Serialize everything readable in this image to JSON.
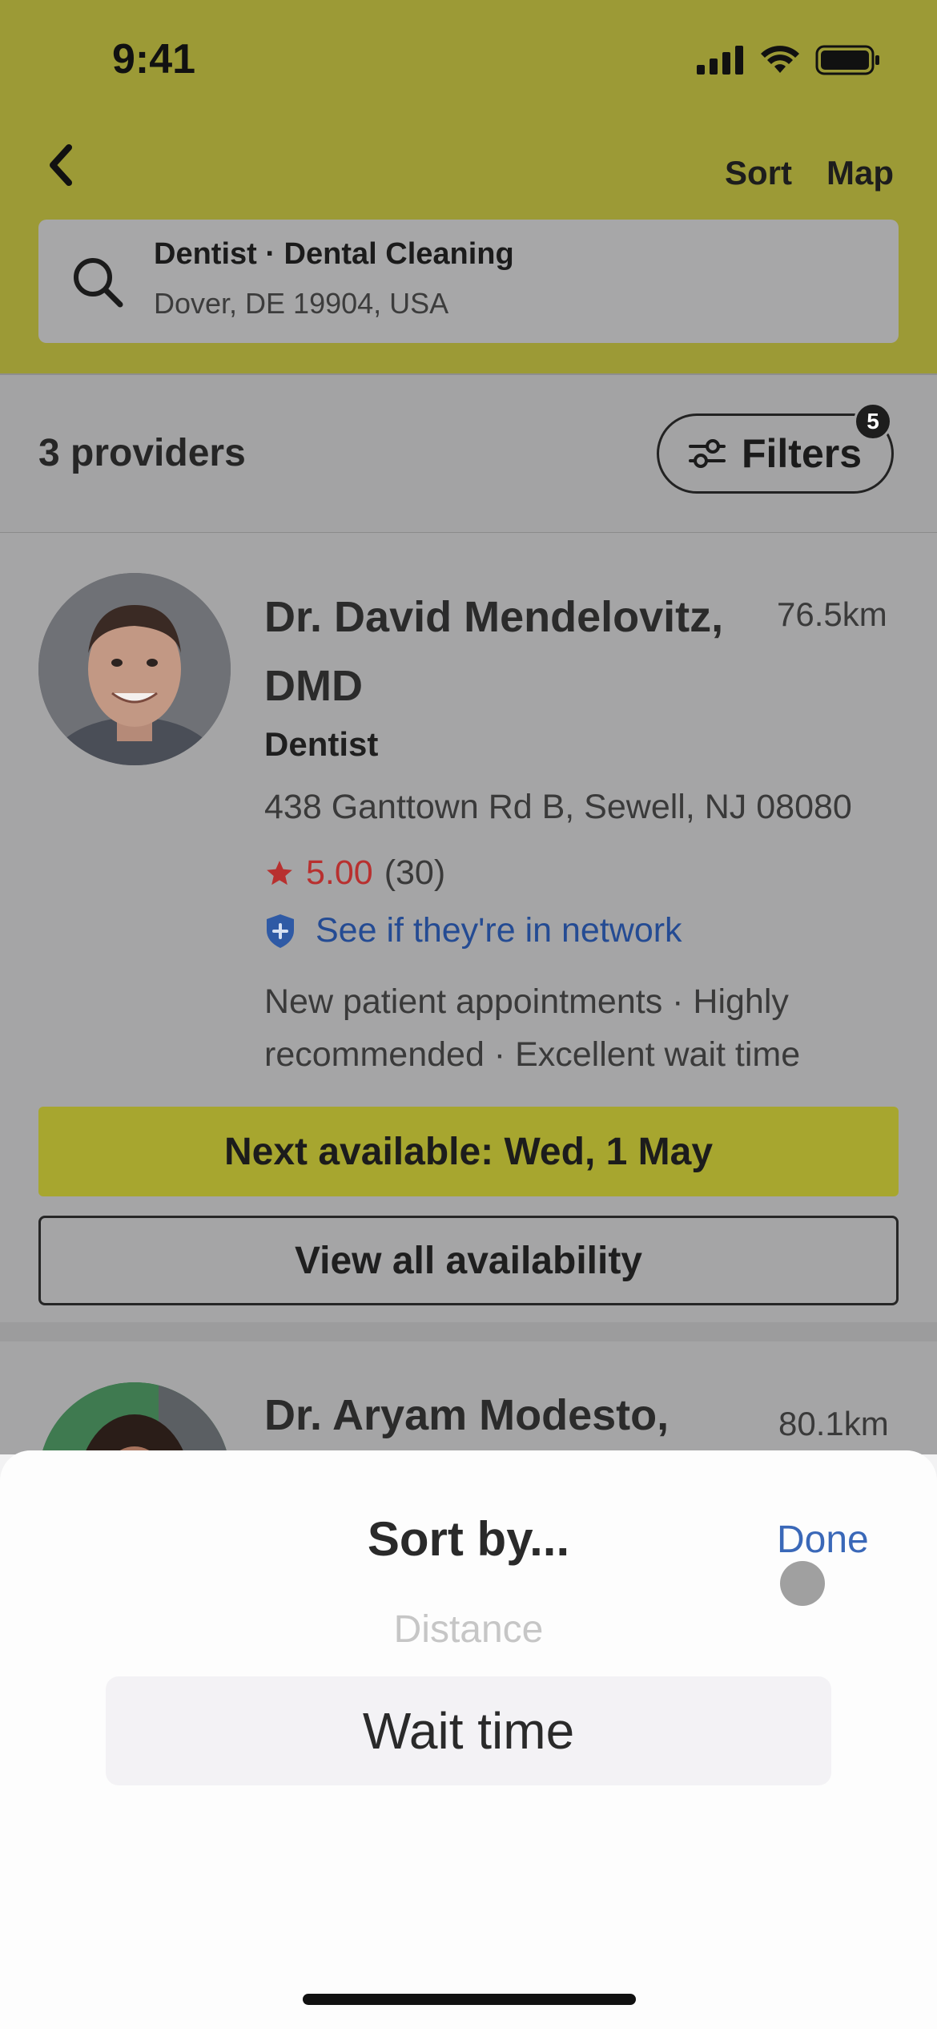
{
  "status_bar": {
    "time": "9:41"
  },
  "header": {
    "sort_label": "Sort",
    "map_label": "Map",
    "search": {
      "title": "Dentist · Dental Cleaning",
      "location": "Dover, DE 19904, USA"
    }
  },
  "results": {
    "count_label": "3 providers",
    "filters_label": "Filters",
    "filters_badge": "5"
  },
  "providers": [
    {
      "name": "Dr. David Mendelovitz, DMD",
      "distance": "76.5km",
      "specialty": "Dentist",
      "address": "438 Ganttown Rd B, Sewell, NJ 08080",
      "rating": "5.00",
      "review_count": "(30)",
      "network_link": "See if they're in network",
      "tags": "New patient appointments · Highly recommended · Excellent wait time",
      "next_available": "Next available: Wed, 1 May",
      "view_all": "View all availability"
    },
    {
      "name": "Dr. Aryam Modesto,",
      "distance": "80.1km"
    }
  ],
  "sort_sheet": {
    "title": "Sort by...",
    "done_label": "Done",
    "options_visible": [
      "Distance",
      "Wait time"
    ],
    "selected": "Wait time"
  },
  "colors": {
    "header_bg": "#9c9a36",
    "accent_link": "#3a68b8",
    "rating_red": "#b8302f"
  }
}
